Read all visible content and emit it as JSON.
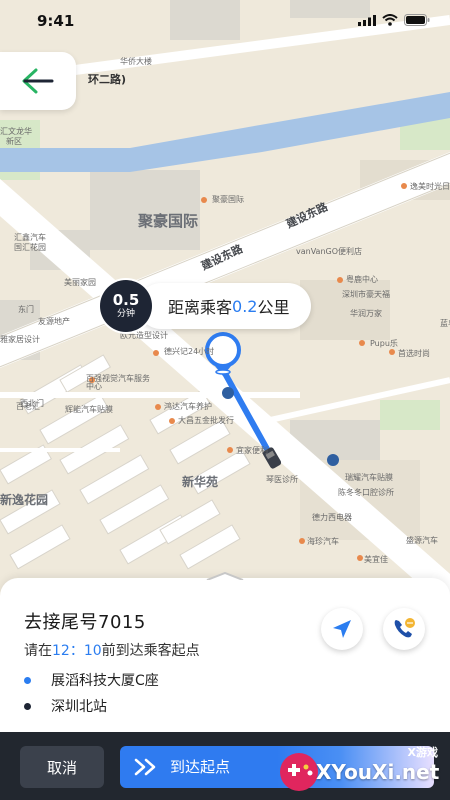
{
  "status_bar": {
    "time": "9:41"
  },
  "map": {
    "roads": [
      {
        "name": "建设东路"
      },
      {
        "name": "建设东路"
      }
    ],
    "areas": [
      {
        "name": "聚豪国际"
      },
      {
        "name": "新华苑"
      },
      {
        "name": "新逸花园"
      }
    ],
    "pois": [
      "华侨大楼",
      "环二路)",
      "汇文龙华",
      "新区",
      "聚豪国际",
      "逸美时光日记",
      "汇鑫汽车",
      "国汇花园",
      "vanVanGO便利店",
      "粤鹿中心",
      "美丽家园",
      "深圳市豪天福",
      "东门",
      "友源地产",
      "蓝鸟科技",
      "华润万家",
      "雅家居设计",
      "欧元造型设计",
      "Pupu乐",
      "德兴记24小时",
      "首选时尚",
      "百强视觉汽车服务中心",
      "百老汇",
      "辉能汽车贴膜",
      "鸿达汽车养护",
      "大昌五金批发行",
      "宜家便利",
      "西北门",
      "新华苑",
      "琴医诊所",
      "瑞耀汽车贴膜",
      "陈冬冬口腔诊所",
      "德力西电器",
      "海珍汽车",
      "盛源汽车",
      "美宜佳"
    ]
  },
  "back_button": {
    "icon": "back-arrow-icon"
  },
  "distance": {
    "eta_value": "0.5",
    "eta_unit": "分钟",
    "prefix": "距离乘客",
    "km": "0.2",
    "suffix": "公里"
  },
  "trip": {
    "title": "去接尾号7015",
    "sub_prefix": "请在",
    "time_h": "12",
    "time_sep": "：",
    "time_m": "10",
    "sub_suffix": "前到达乘客起点",
    "origin": "展滔科技大厦C座",
    "destination": "深圳北站",
    "origin_color": "#2b7df0",
    "destination_color": "#1e2534"
  },
  "actions": {
    "cancel": "取消",
    "arrive": "到达起点"
  },
  "watermark": {
    "small": "X游戏",
    "site": "XYouXi.net"
  },
  "colors": {
    "accent": "#2b7df0",
    "dark": "#1e2534",
    "action_bar": "#22272f"
  }
}
